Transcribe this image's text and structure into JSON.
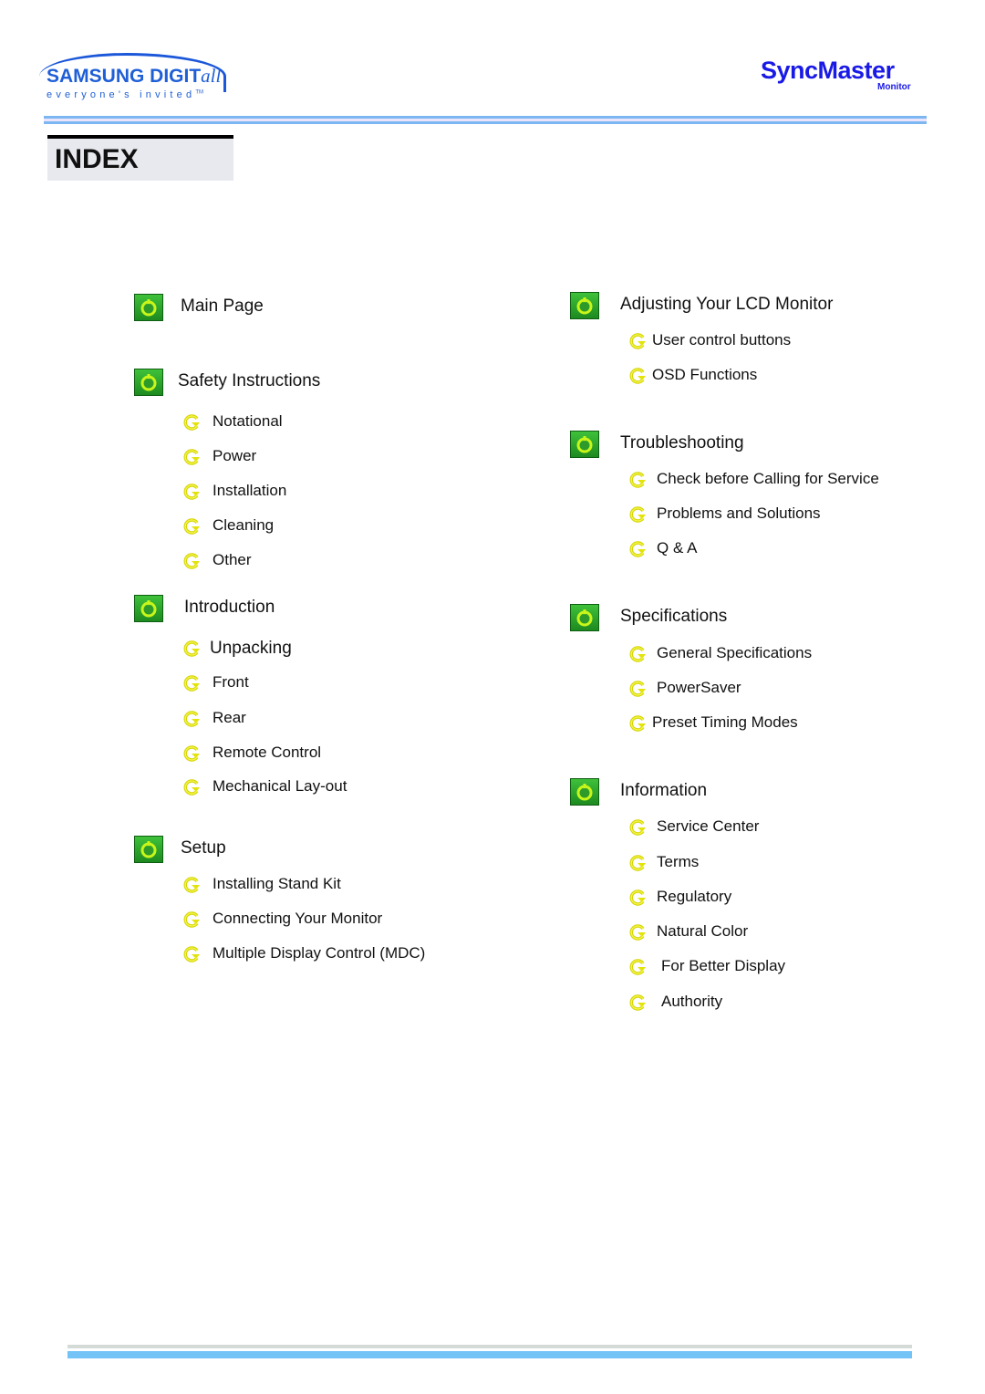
{
  "header": {
    "brand_logo": {
      "name": "SAMSUNG DIGIT",
      "name_script": "all",
      "tagline": "everyone's invited",
      "tagline_mark": "TM"
    },
    "product_logo": {
      "name": "SyncMaster",
      "sub": "Monitor"
    }
  },
  "page_title": "INDEX",
  "colors": {
    "accent_blue": "#1f5fd6",
    "section_icon_green": "#2fae2c",
    "bullet_yellow": "#e3e30a",
    "rule_blue": "#7db7f2"
  },
  "left_column": {
    "sections": [
      {
        "label": "Main Page",
        "icon": "power-icon",
        "items": []
      },
      {
        "label": "Safety Instructions",
        "icon": "power-icon",
        "items": [
          "Notational",
          "Power",
          "Installation",
          "Cleaning",
          "Other"
        ]
      },
      {
        "label": "Introduction",
        "icon": "power-icon",
        "items": [
          "Unpacking",
          "Front",
          "Rear",
          "Remote Control",
          "Mechanical Lay-out"
        ]
      },
      {
        "label": "Setup",
        "icon": "power-icon",
        "items": [
          "Installing Stand Kit",
          "Connecting Your Monitor",
          "Multiple Display Control (MDC)"
        ]
      }
    ]
  },
  "right_column": {
    "sections": [
      {
        "label": "Adjusting Your LCD Monitor",
        "icon": "power-icon",
        "items": [
          "User control buttons",
          "OSD Functions"
        ]
      },
      {
        "label": "Troubleshooting",
        "icon": "power-icon",
        "items": [
          "Check before Calling for Service",
          "Problems and Solutions",
          "Q & A"
        ]
      },
      {
        "label": "Specifications",
        "icon": "power-icon",
        "items": [
          "General Specifications",
          "PowerSaver",
          "Preset Timing Modes"
        ]
      },
      {
        "label": "Information",
        "icon": "power-icon",
        "items": [
          "Service Center",
          "Terms",
          "Regulatory",
          "Natural Color",
          "For Better Display",
          "Authority"
        ]
      }
    ]
  }
}
